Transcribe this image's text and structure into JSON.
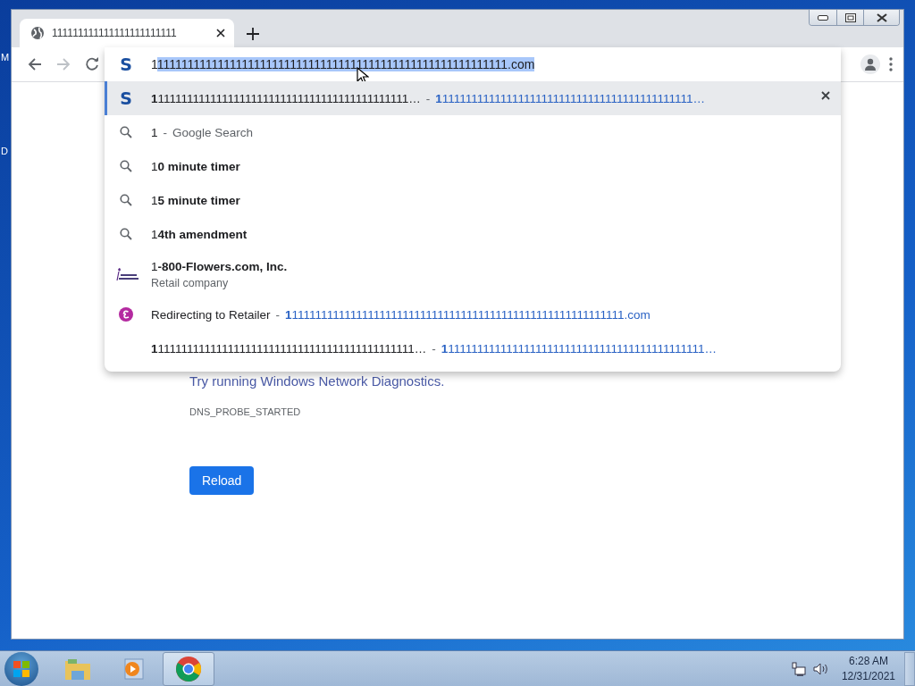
{
  "desktop": {
    "icon_labels": [
      "M",
      "D"
    ]
  },
  "browser": {
    "tab": {
      "title": "111111111111111111111111",
      "selected": true
    },
    "omnibox": {
      "favicon_letter": "S",
      "typed": "1",
      "autocomplete": "1111111111111111111111111111111111111111111111111111111111.com"
    },
    "suggestions": [
      {
        "kind": "site",
        "favicon_letter": "S",
        "text": "**1**1111111111111111111111111111111111111111111…",
        "separator": "-",
        "url": "**1**1111111111111111111111111111111111111111111…",
        "selected": true
      },
      {
        "kind": "search",
        "text": "1",
        "separator": "-",
        "description": "Google Search",
        "selected": false
      },
      {
        "kind": "search",
        "text": "1**0 minute timer**",
        "selected": false
      },
      {
        "kind": "search",
        "text": "1**5 minute timer**",
        "selected": false
      },
      {
        "kind": "search",
        "text": "1**4th amendment**",
        "selected": false
      },
      {
        "kind": "entity",
        "text": "1**-800-Flowers.com, Inc.**",
        "description": "Retail company",
        "selected": false
      },
      {
        "kind": "redirect",
        "text": "Redirecting to Retailer",
        "separator": "-",
        "url": "**1**111111111111111111111111111111111111111111111111111111111.com",
        "selected": false
      },
      {
        "kind": "url",
        "text": "**1**11111111111111111111111111111111111111111111…",
        "separator": "-",
        "url": "**1**11111111111111111111111111111111111111111111…",
        "selected": false
      }
    ]
  },
  "page": {
    "message": "Try running Windows Network Diagnostics.",
    "error_code": "DNS_PROBE_STARTED",
    "reload_button": "Reload"
  },
  "taskbar": {
    "apps": [
      {
        "kind": "explorer",
        "selected": false
      },
      {
        "kind": "media",
        "selected": false
      },
      {
        "kind": "browser",
        "selected": true
      }
    ],
    "clock": {
      "time": "6:28 AM",
      "date": "12/31/2021"
    }
  }
}
